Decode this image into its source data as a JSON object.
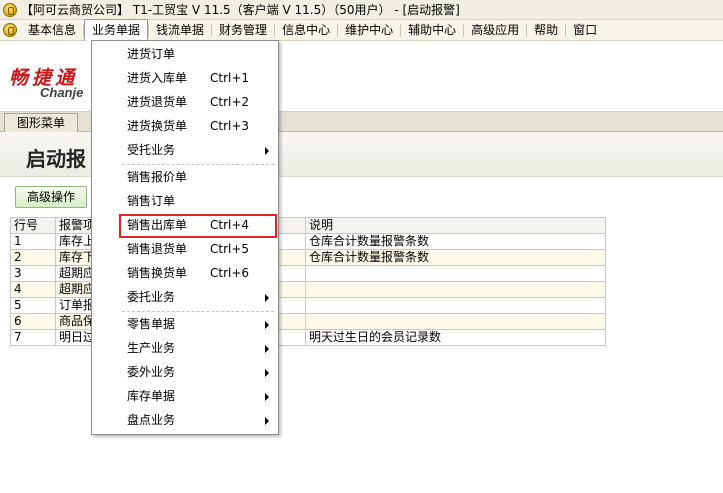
{
  "window": {
    "title": "【阿可云商贸公司】 T1-工贸宝 V 11.5（客户端 V 11.5）（50用户） - [启动报警]"
  },
  "menubar": {
    "items": [
      {
        "label": "基本信息"
      },
      {
        "label": "业务单据"
      },
      {
        "label": "钱流单据"
      },
      {
        "label": "财务管理"
      },
      {
        "label": "信息中心"
      },
      {
        "label": "维护中心"
      },
      {
        "label": "辅助中心"
      },
      {
        "label": "高级应用"
      },
      {
        "label": "帮助"
      },
      {
        "label": "窗口"
      }
    ]
  },
  "logo": {
    "cn": "畅捷通",
    "en": "Chanje"
  },
  "tabs": [
    {
      "label": "图形菜单"
    }
  ],
  "page": {
    "title": "启动报",
    "advanced_button": "高级操作"
  },
  "table": {
    "headers": [
      "行号",
      "报警项",
      "说明"
    ],
    "rows": [
      {
        "no": "1",
        "item": "库存上",
        "desc": "仓库合计数量报警条数"
      },
      {
        "no": "2",
        "item": "库存下",
        "desc": "仓库合计数量报警条数"
      },
      {
        "no": "3",
        "item": "超期应",
        "desc": ""
      },
      {
        "no": "4",
        "item": "超期应",
        "desc": ""
      },
      {
        "no": "5",
        "item": "订单报",
        "desc": ""
      },
      {
        "no": "6",
        "item": "商品保",
        "desc": ""
      },
      {
        "no": "7",
        "item": "明日过",
        "desc": "明天过生日的会员记录数"
      }
    ]
  },
  "dropdown": {
    "items": [
      {
        "label": "进货订单",
        "shortcut": "",
        "submenu": false
      },
      {
        "label": "进货入库单",
        "shortcut": "Ctrl+1",
        "submenu": false
      },
      {
        "label": "进货退货单",
        "shortcut": "Ctrl+2",
        "submenu": false
      },
      {
        "label": "进货换货单",
        "shortcut": "Ctrl+3",
        "submenu": false
      },
      {
        "label": "受托业务",
        "shortcut": "",
        "submenu": true
      },
      {
        "label": "销售报价单",
        "shortcut": "",
        "submenu": false
      },
      {
        "label": "销售订单",
        "shortcut": "",
        "submenu": false
      },
      {
        "label": "销售出库单",
        "shortcut": "Ctrl+4",
        "submenu": false
      },
      {
        "label": "销售退货单",
        "shortcut": "Ctrl+5",
        "submenu": false
      },
      {
        "label": "销售换货单",
        "shortcut": "Ctrl+6",
        "submenu": false
      },
      {
        "label": "委托业务",
        "shortcut": "",
        "submenu": true
      },
      {
        "label": "零售单据",
        "shortcut": "",
        "submenu": true
      },
      {
        "label": "生产业务",
        "shortcut": "",
        "submenu": true
      },
      {
        "label": "委外业务",
        "shortcut": "",
        "submenu": true
      },
      {
        "label": "库存单据",
        "shortcut": "",
        "submenu": true
      },
      {
        "label": "盘点业务",
        "shortcut": "",
        "submenu": true
      }
    ],
    "highlighted": "销售出库单",
    "highlight_color": "#e02424"
  }
}
